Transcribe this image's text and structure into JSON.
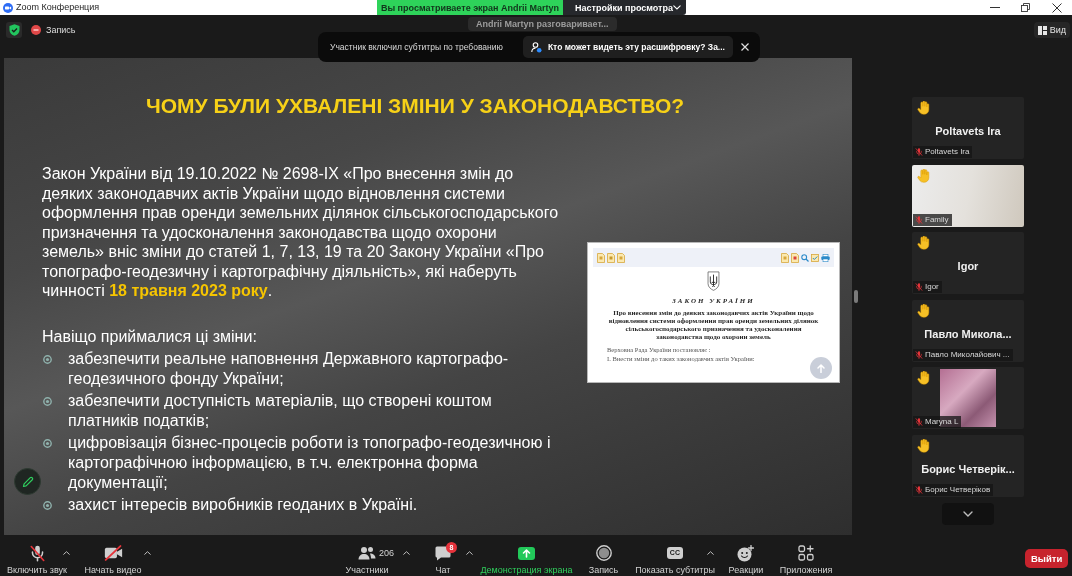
{
  "title_bar": {
    "app_title": "Zoom Конференция",
    "viewing_banner": "Вы просматриваете экран Andrii Martyn",
    "view_options_button": "Настройки просмотра"
  },
  "meeting_header": {
    "recording_label": "Запись",
    "view_button": "Вид"
  },
  "speaker_indicator": "Andrii Martyn разговаривает...",
  "notification": {
    "message": "Участник включил субтитры по требованию",
    "action_button": "Кто может видеть эту расшифровку? За..."
  },
  "shared_slide": {
    "title": "ЧОМУ БУЛИ УХВАЛЕНІ ЗМІНИ У ЗАКОНОДАВСТВО?",
    "paragraph": "Закон України від 19.10.2022 № 2698-IX «Про внесення змін до деяких законодавчих актів України щодо відновлення системи оформлення прав оренди земельних ділянок сільськогосподарського призначення та удосконалення законодавства щодо охорони земель» вніс зміни до статей 1, 7, 13, 19 та 20 Закону України «Про топографо-геодезичну і картографічну діяльність», які наберуть чинності **18 травня 2023 року**.",
    "list_heading": "Навіщо приймалися ці зміни:",
    "bullets": [
      "забезпечити реальне наповнення Державного картографо-геодезичного фонду України;",
      "забезпечити доступність матеріалів, що створені коштом платників податків;",
      "цифровізація бізнес-процесів роботи із топографо-геодезичною і картографічною інформацією, в т.ч. електронна форма документації;",
      "захист інтересів виробників геоданих в Україні."
    ],
    "document": {
      "heading": "ЗАКОН УКРАЇНИ",
      "title": "Про внесення змін до деяких законодавчих актів України щодо відновлення системи оформлення прав оренди земельних ділянок сільськогосподарського призначення та удосконалення законодавства щодо охорони земель",
      "lines": [
        "Верховна Рада України постановляє :",
        "I. Внести зміни до таких законодавчих актів України:"
      ]
    }
  },
  "participants": [
    {
      "kind": "name",
      "name": "Poltavets Ira",
      "tag": "Poltavets Ira",
      "hand_raised": true,
      "muted": true
    },
    {
      "kind": "video",
      "tag": "Family",
      "hand_raised": true,
      "muted": true
    },
    {
      "kind": "name",
      "name": "Igor",
      "tag": "Igor",
      "hand_raised": true,
      "muted": true
    },
    {
      "kind": "name",
      "name": "Павло Микола...",
      "tag": "Павло Миколайович ...",
      "hand_raised": true,
      "muted": true
    },
    {
      "kind": "photo",
      "tag": "Maryna L",
      "hand_raised": true,
      "muted": true
    },
    {
      "kind": "name",
      "name": "Борис Четверік...",
      "tag": "Борис Четверіков",
      "hand_raised": true,
      "muted": true
    }
  ],
  "toolbar": {
    "left": [
      {
        "kind": "mic",
        "label": "Включить звук",
        "muted": true,
        "caret": true
      },
      {
        "kind": "camera",
        "label": "Начать видео",
        "off": true,
        "caret": true
      }
    ],
    "center": [
      {
        "kind": "participants",
        "label": "Участники",
        "count": "206",
        "caret": true
      },
      {
        "kind": "chat",
        "label": "Чат",
        "badge": "8",
        "caret": true
      },
      {
        "kind": "share",
        "label": "Демонстрация экрана"
      },
      {
        "kind": "record",
        "label": "Запись"
      },
      {
        "kind": "captions",
        "label": "Показать субтитры",
        "icon_text": "CC",
        "caret": true
      },
      {
        "kind": "reactions",
        "label": "Реакции"
      },
      {
        "kind": "apps",
        "label": "Приложения"
      }
    ],
    "leave_button": "Выйти"
  }
}
